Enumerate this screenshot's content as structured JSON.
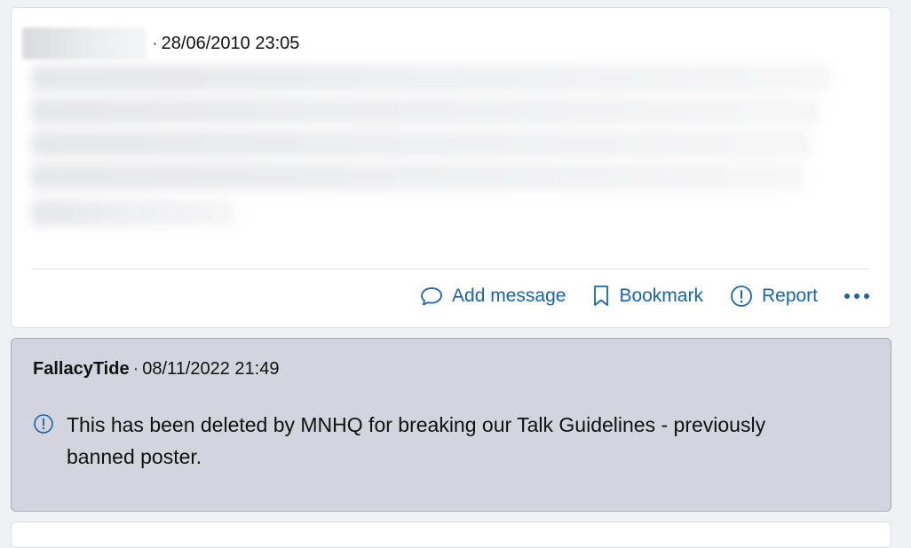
{
  "post1": {
    "date": "28/06/2010 23:05",
    "separator": "·",
    "actions": {
      "add_message": "Add message",
      "bookmark": "Bookmark",
      "report": "Report"
    }
  },
  "post2": {
    "username": "FallacyTide",
    "separator": "·",
    "date": "08/11/2022 21:49",
    "notice": "This has been deleted by MNHQ for breaking our Talk Guidelines - previously banned poster."
  },
  "icons": [
    "speech-bubble-icon",
    "bookmark-icon",
    "exclamation-circle-icon",
    "more-dots-icon",
    "info-circle-icon"
  ],
  "colors": {
    "link": "#1b63a8",
    "deleted_bg": "#d2d5de",
    "card_bg": "#ffffff"
  }
}
